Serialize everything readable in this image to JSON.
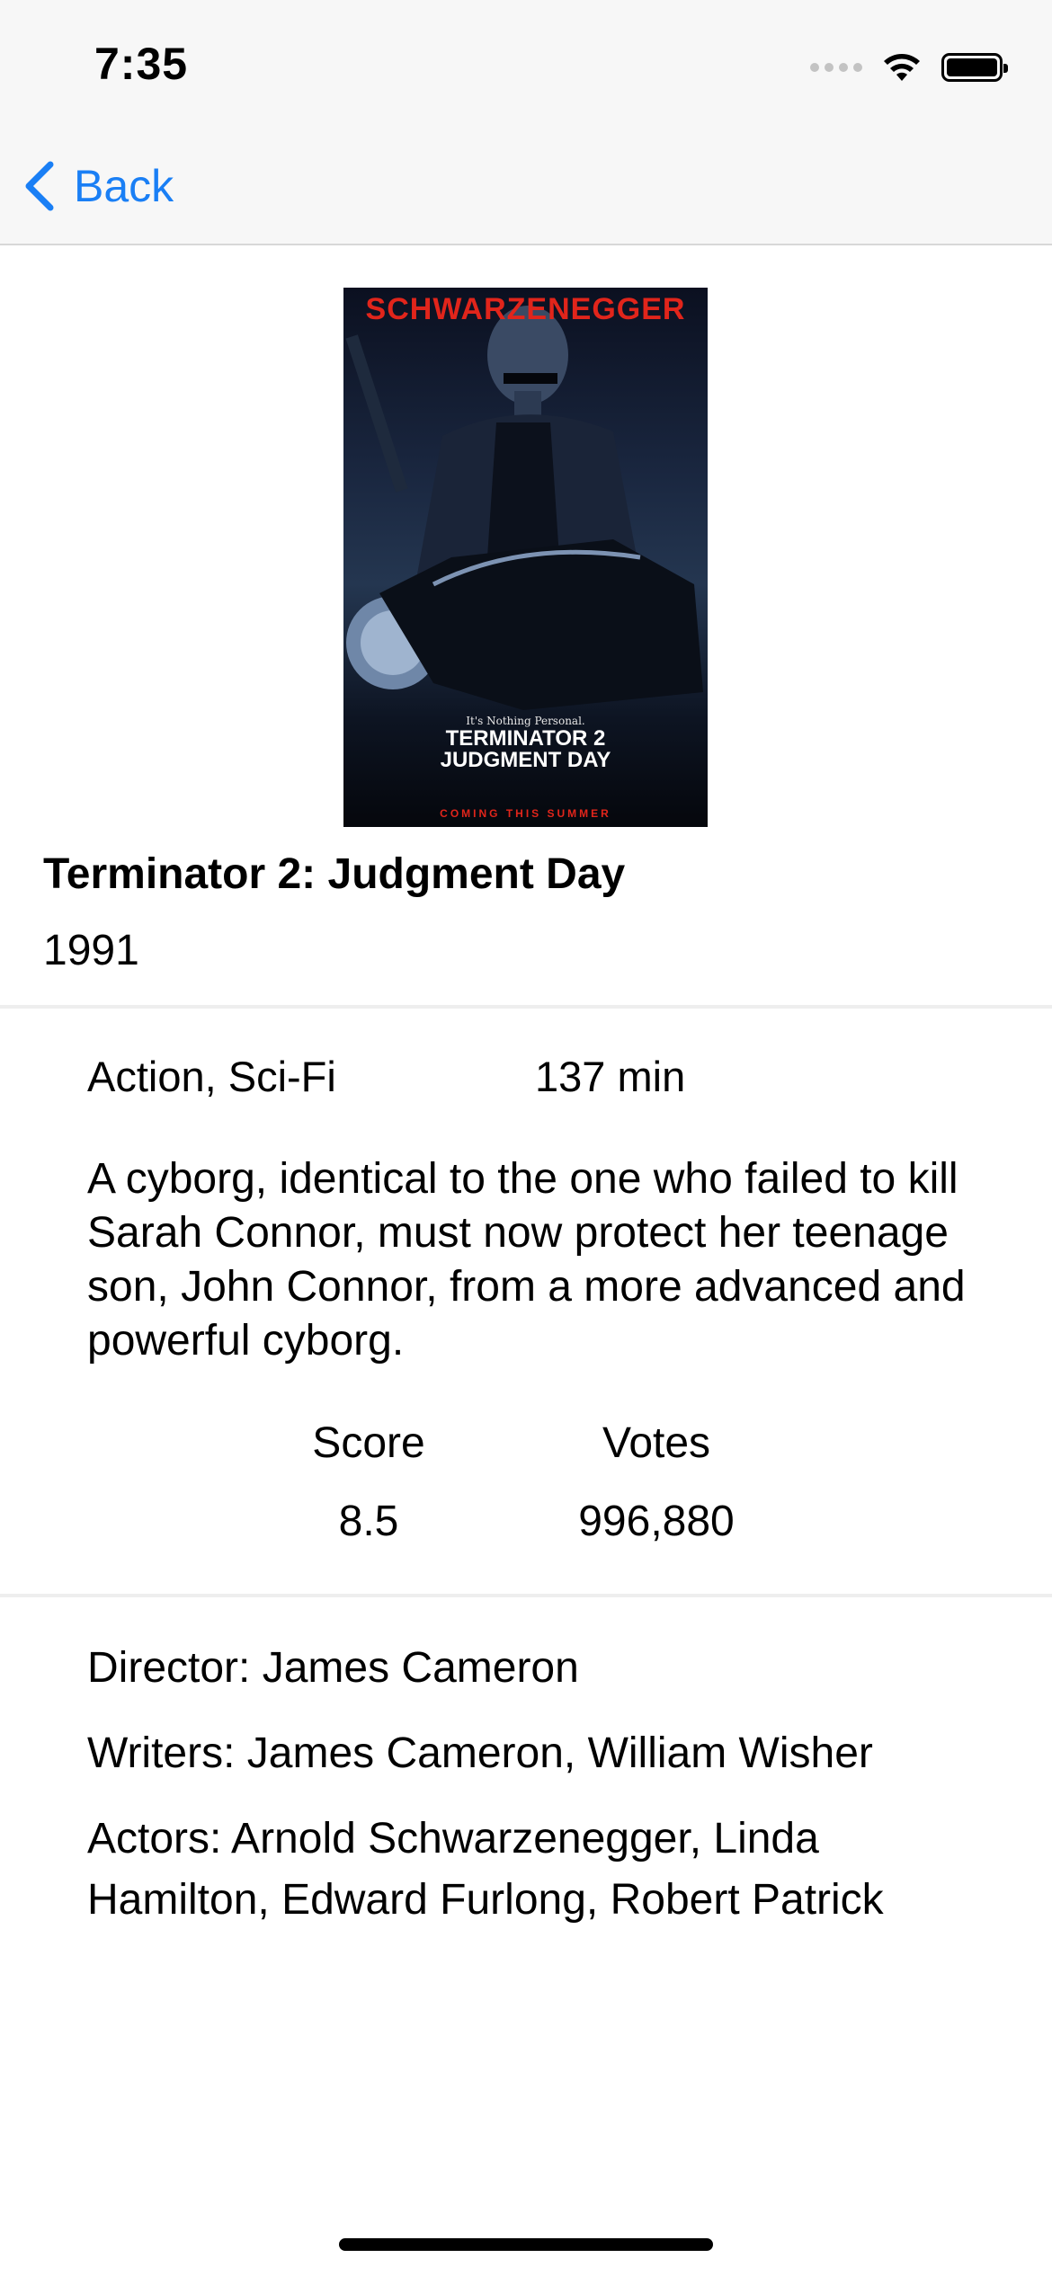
{
  "status_bar": {
    "time": "7:35"
  },
  "nav": {
    "back_label": "Back",
    "accent_color": "#1a7ff5"
  },
  "poster": {
    "top_text": "SCHWARZENEGGER",
    "tagline": "It's Nothing Personal.",
    "title_line1": "TERMINATOR 2",
    "title_line2": "JUDGMENT DAY",
    "bottom_text": "COMING THIS SUMMER"
  },
  "movie": {
    "title": "Terminator 2: Judgment Day",
    "year": "1991",
    "genre": "Action, Sci-Fi",
    "runtime": "137 min",
    "plot": "A cyborg, identical to the one who failed to kill Sarah Connor, must now protect her teenage son, John Connor, from a more advanced and powerful cyborg.",
    "score_label": "Score",
    "score_value": "8.5",
    "votes_label": "Votes",
    "votes_value": "996,880",
    "director": "Director: James Cameron",
    "writers": "Writers: James Cameron, William Wisher",
    "actors": "Actors: Arnold Schwarzenegger, Linda Hamilton, Edward Furlong, Robert Patrick"
  }
}
